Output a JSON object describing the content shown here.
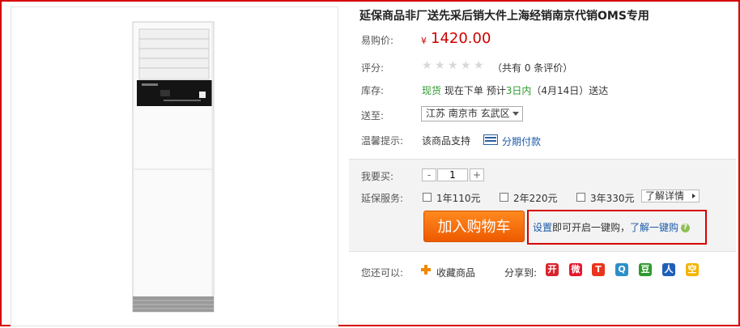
{
  "product": {
    "title": "延保商品非厂送先采后销大件上海经销南京代销OMS专用",
    "image_alt": "立式空调柜机"
  },
  "price": {
    "label": "易购价:",
    "currency": "¥",
    "value": "1420.00"
  },
  "rating": {
    "label": "评分:",
    "stars": 5,
    "filled": 0,
    "text": "（共有 0 条评价）"
  },
  "stock": {
    "label": "库存:",
    "status": "现货",
    "order_now": "现在下单",
    "estimate_prefix": "预计",
    "estimate_days": "3日内",
    "estimate_suffix": "（4月14日）送达"
  },
  "delivery": {
    "label": "送至:",
    "region": "江苏 南京市 玄武区"
  },
  "tip": {
    "label": "温馨提示:",
    "text": "该商品支持",
    "link": "分期付款"
  },
  "purchase": {
    "qty_label": "我要买:",
    "minus": "-",
    "qty": "1",
    "plus": "+"
  },
  "warranty": {
    "label": "延保服务:",
    "options": [
      "1年110元",
      "2年220元",
      "3年330元"
    ],
    "detail_link": "了解详情"
  },
  "cart": {
    "button": "加入购物车",
    "oneclick_setup": "设置",
    "oneclick_text": "即可开启一键购，",
    "oneclick_learn": "了解一键购"
  },
  "more": {
    "label": "您还可以:",
    "favorite": "收藏商品",
    "share_label": "分享到:",
    "share_icons": [
      {
        "name": "kaixin-icon",
        "glyph": "开",
        "color": "#d9232d"
      },
      {
        "name": "weibo-icon",
        "glyph": "微",
        "color": "#e6162d"
      },
      {
        "name": "tianya-icon",
        "glyph": "T",
        "color": "#e8351e"
      },
      {
        "name": "qq-weibo-icon",
        "glyph": "Q",
        "color": "#2b8fc9"
      },
      {
        "name": "douban-icon",
        "glyph": "豆",
        "color": "#2e9a2e"
      },
      {
        "name": "renren-icon",
        "glyph": "人",
        "color": "#1f5fb8"
      },
      {
        "name": "qzone-icon",
        "glyph": "空",
        "color": "#f4b400"
      }
    ]
  }
}
